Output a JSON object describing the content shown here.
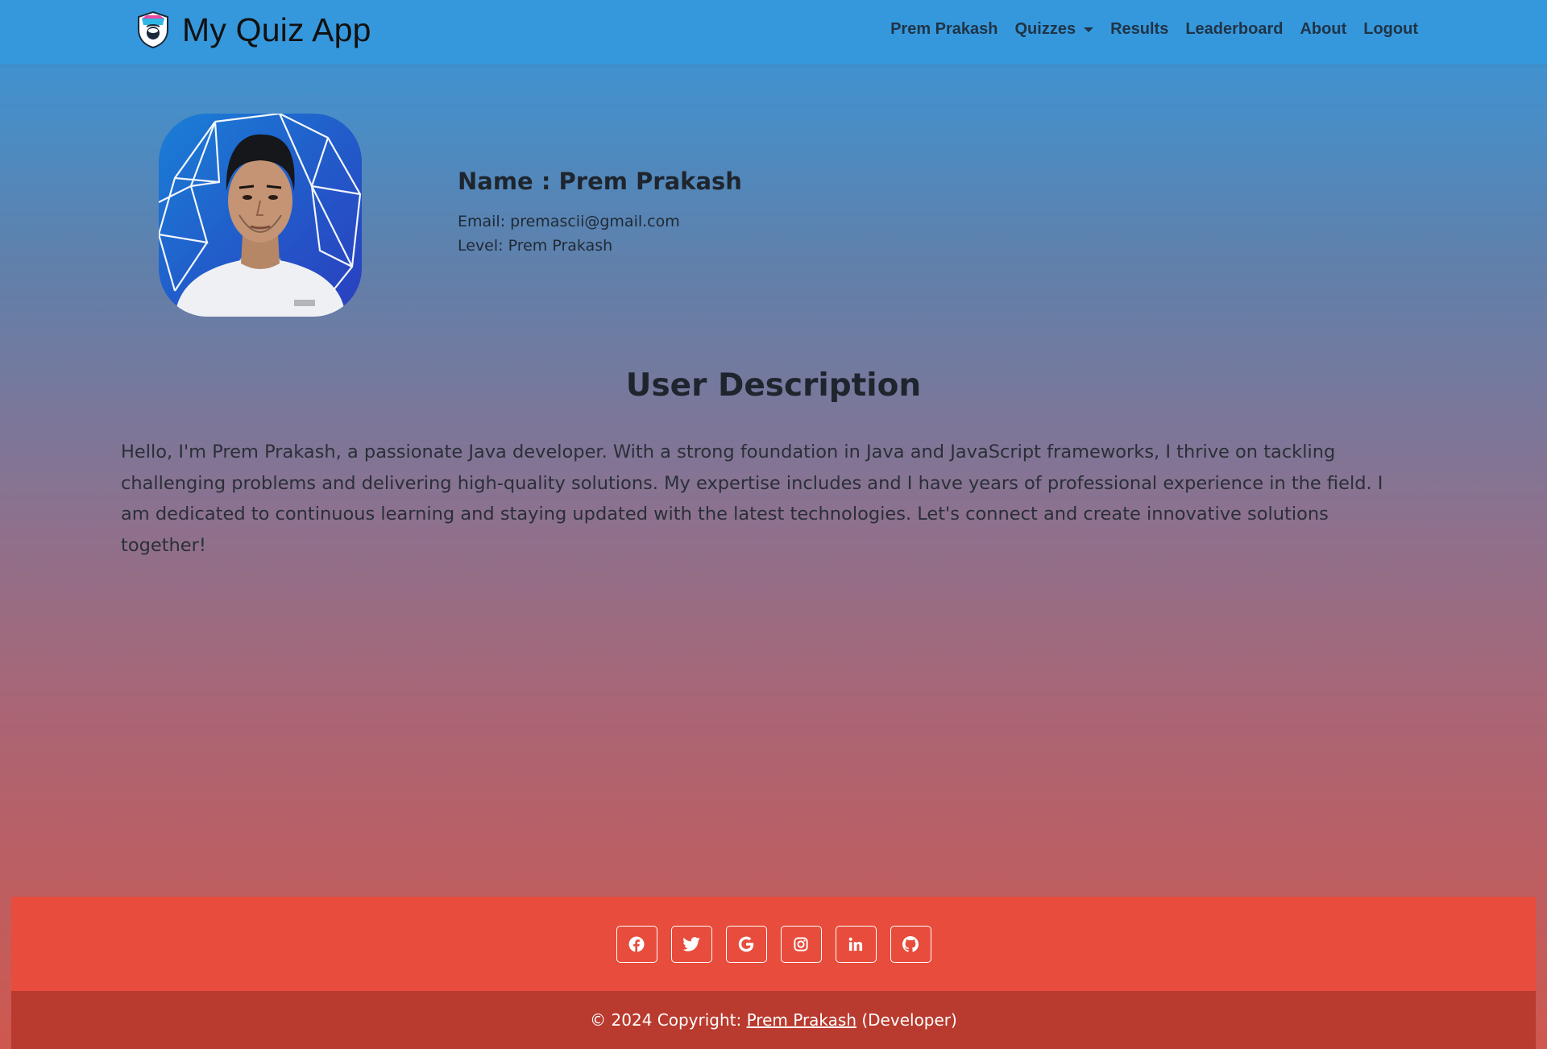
{
  "navbar": {
    "brand": "My Quiz App",
    "links": {
      "user": "Prem Prakash",
      "quizzes": "Quizzes",
      "results": "Results",
      "leaderboard": "Leaderboard",
      "about": "About",
      "logout": "Logout"
    }
  },
  "profile": {
    "name": "Name : Prem Prakash",
    "email": "Email: premascii@gmail.com",
    "level": "Level: Prem Prakash"
  },
  "description": {
    "title": "User Description",
    "text": "Hello, I'm Prem Prakash, a passionate Java developer. With a strong foundation in Java and JavaScript frameworks, I thrive on tackling challenging problems and delivering high-quality solutions. My expertise includes and I have years of professional experience in the field. I am dedicated to continuous learning and staying updated with the latest technologies. Let's connect and create innovative solutions together!"
  },
  "footer": {
    "social": [
      "facebook-icon",
      "twitter-icon",
      "google-icon",
      "instagram-icon",
      "linkedin-icon",
      "github-icon"
    ],
    "copyright_prefix": "© 2024 Copyright: ",
    "copyright_link": "Prem Prakash",
    "copyright_suffix": " (Developer)"
  },
  "colors": {
    "navbar": "#3698dc",
    "footer_social": "#e74c3c",
    "footer_copy": "#b93a2e"
  }
}
